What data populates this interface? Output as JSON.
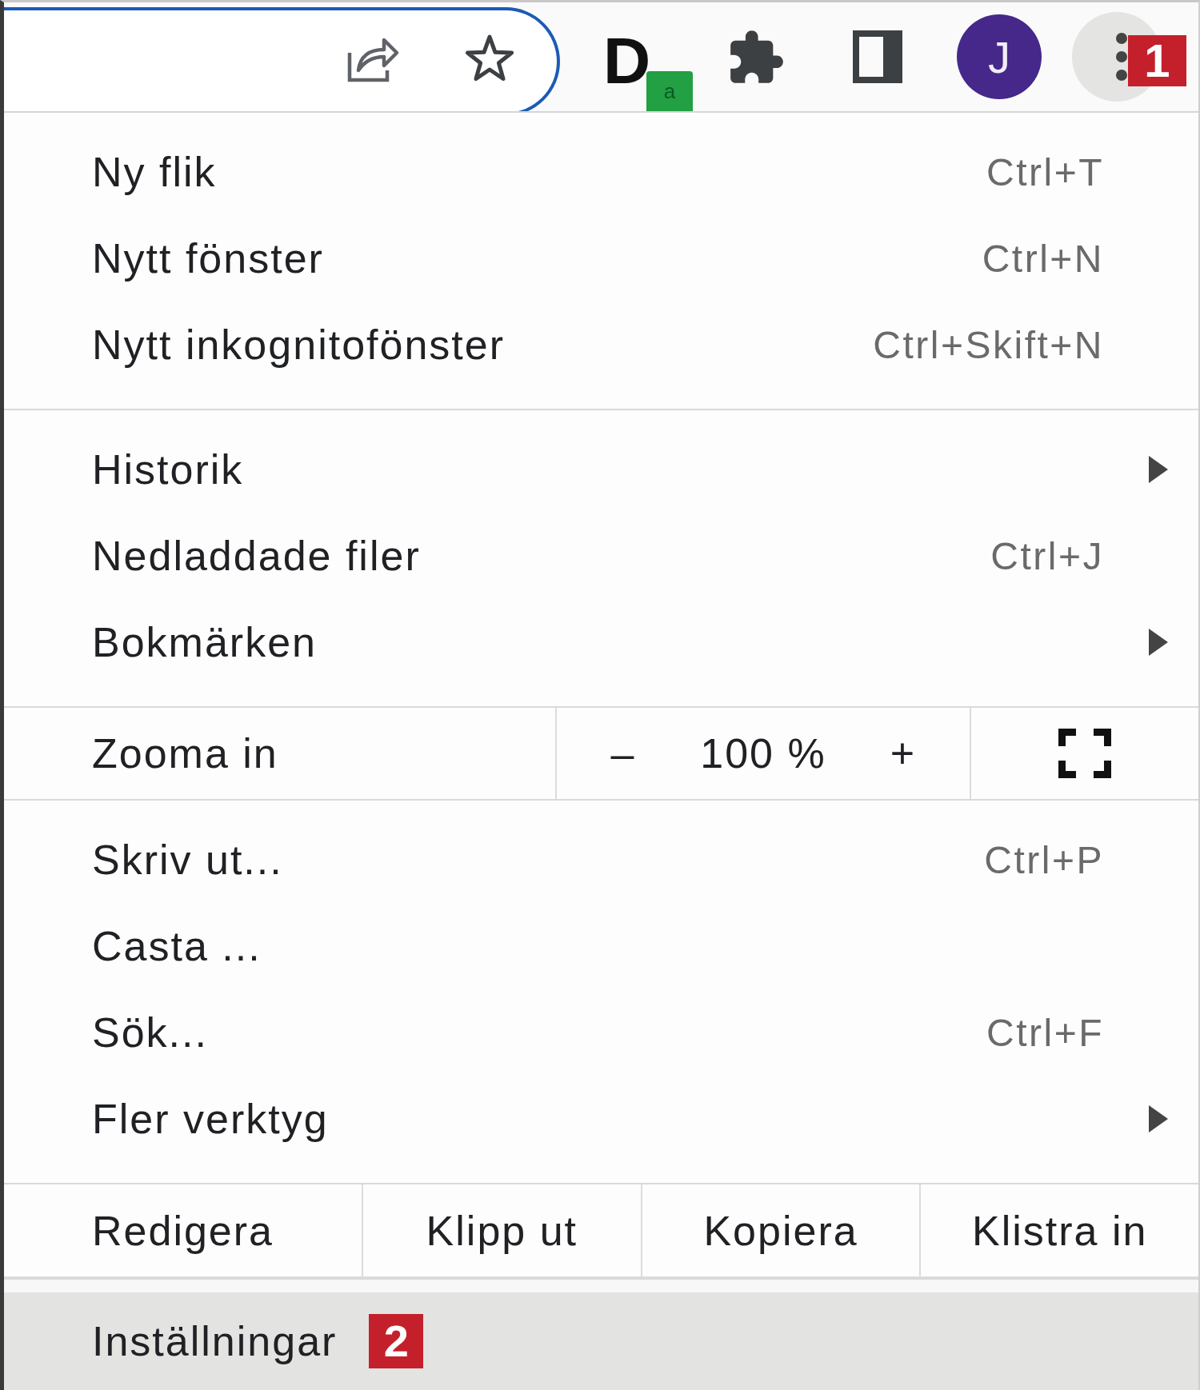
{
  "toolbar": {
    "extension": {
      "logo": "D",
      "badge": "a"
    },
    "avatar": {
      "letter": "J"
    },
    "callout": "1"
  },
  "menu": {
    "sections": [
      {
        "rows": [
          {
            "kind": "command",
            "label": "Ny flik",
            "shortcut": "Ctrl+T",
            "selected": false
          },
          {
            "kind": "command",
            "label": "Nytt fönster",
            "shortcut": "Ctrl+N",
            "selected": false
          },
          {
            "kind": "command",
            "label": "Nytt inkognitofönster",
            "shortcut": "Ctrl+Skift+N",
            "selected": false
          }
        ]
      },
      {
        "rows": [
          {
            "kind": "submenu",
            "label": "Historik",
            "selected": false
          },
          {
            "kind": "command",
            "label": "Nedladdade filer",
            "shortcut": "Ctrl+J",
            "selected": false
          },
          {
            "kind": "submenu",
            "label": "Bokmärken",
            "selected": false
          }
        ]
      },
      {
        "rows": [
          {
            "kind": "zoom",
            "label": "Zooma in",
            "minus": "–",
            "value": "100 %",
            "plus": "+"
          }
        ]
      },
      {
        "rows": [
          {
            "kind": "command",
            "label": "Skriv ut...",
            "shortcut": "Ctrl+P",
            "selected": false
          },
          {
            "kind": "command",
            "label": "Casta ...",
            "selected": false
          },
          {
            "kind": "command",
            "label": "Sök...",
            "shortcut": "Ctrl+F",
            "selected": false
          },
          {
            "kind": "submenu",
            "label": "Fler verktyg",
            "selected": false
          }
        ]
      },
      {
        "rows": [
          {
            "kind": "edit",
            "label": "Redigera",
            "buttons": [
              "Klipp ut",
              "Kopiera",
              "Klistra in"
            ]
          }
        ]
      },
      {
        "rows": [
          {
            "kind": "command",
            "label": "Inställningar",
            "selected": true,
            "callout": "2"
          }
        ]
      }
    ]
  }
}
